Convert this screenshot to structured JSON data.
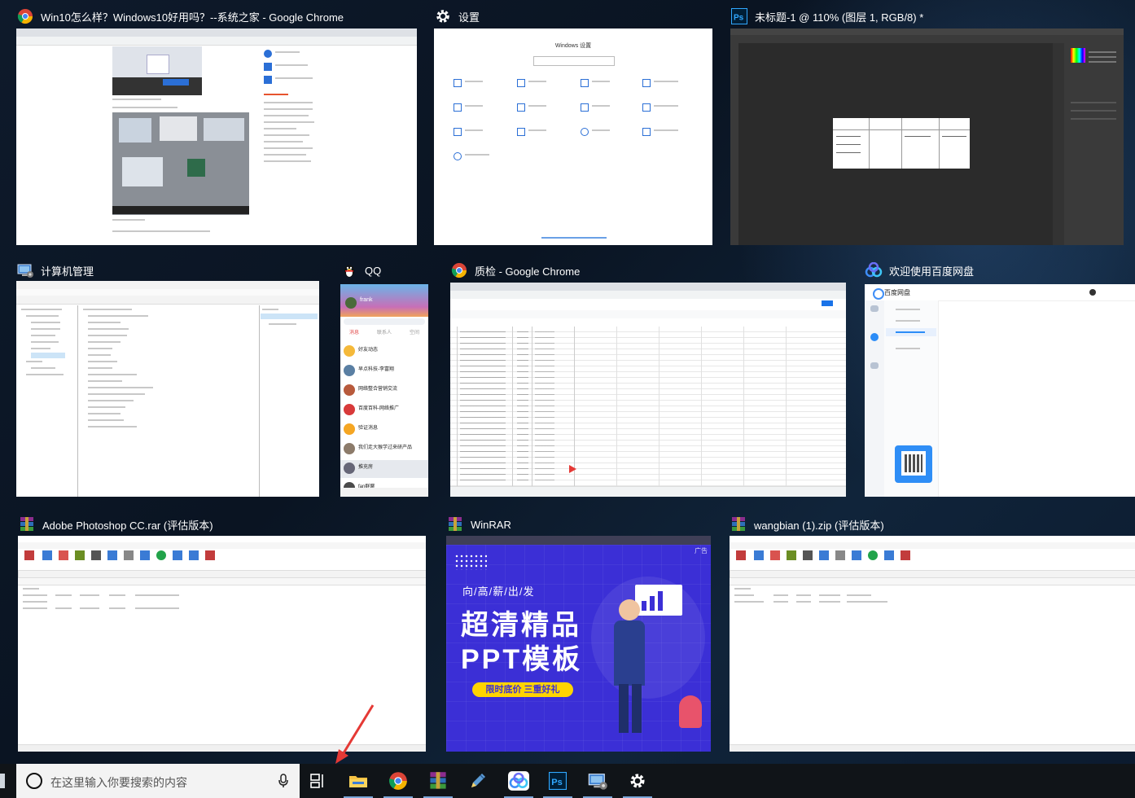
{
  "windows": {
    "chrome_win10": {
      "title": "Win10怎么样？Windows10好用吗？--系统之家 - Google Chrome"
    },
    "settings": {
      "title": "设置",
      "thumb_heading": "Windows 设置"
    },
    "photoshop": {
      "title": "未标题-1 @ 110% (图层 1, RGB/8) *"
    },
    "computer_mgmt": {
      "title": "计算机管理"
    },
    "qq": {
      "title": "QQ",
      "profile_name": "frank",
      "tabs": [
        "消息",
        "联系人",
        "空间"
      ],
      "chats": [
        "好友动态",
        "早点科技-李富翔",
        "网络整合营销交流",
        "百度百科-网络推广",
        "验证消息",
        "我们走大猴学过来研产品",
        "推充房",
        "fan群聊"
      ]
    },
    "chrome_zhijian": {
      "title": "质检 - Google Chrome"
    },
    "baidu": {
      "title": "欢迎使用百度网盘",
      "app_name": "百度网盘"
    },
    "winrar_ps": {
      "title": "Adobe Photoshop CC.rar (评估版本)"
    },
    "winrar": {
      "title": "WinRAR",
      "ad_sub": "向/高/薪/出/发",
      "ad_line1": "超清精品",
      "ad_line2": "PPT模板",
      "ad_btn": "限时底价  三重好礼",
      "ad_tag": "广告"
    },
    "winrar_zip": {
      "title": "wangbian (1).zip (评估版本)"
    }
  },
  "taskbar": {
    "search_placeholder": "在这里输入你要搜索的内容",
    "icons": [
      "task-view",
      "file-explorer",
      "chrome",
      "winrar",
      "pen",
      "baidu-netdisk",
      "photoshop",
      "computer-management",
      "settings"
    ]
  },
  "colors": {
    "desktop": "#0e1a2b",
    "taskbar": "#101418",
    "ps_blue": "#31a8ff",
    "winrar_purple": "#3b2fd6",
    "accent_red": "#e23b2e"
  }
}
